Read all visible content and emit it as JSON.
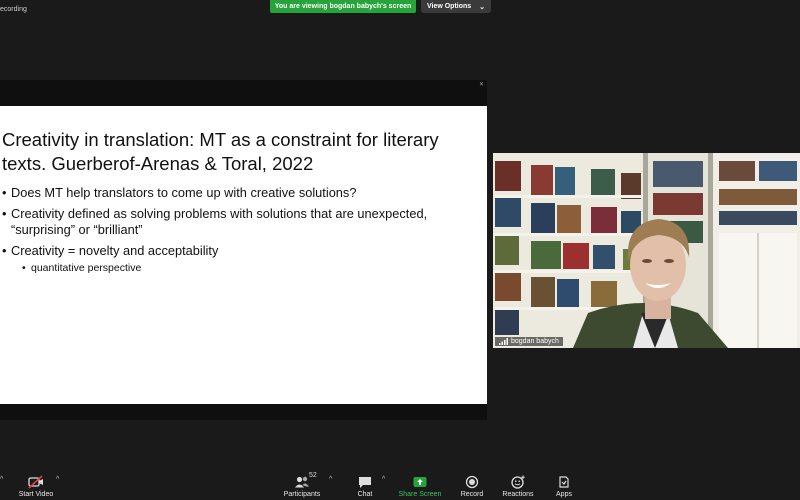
{
  "window": {
    "recording_label": "ecording"
  },
  "banner": {
    "text": "You are viewing bogdan babych's screen"
  },
  "view_options": {
    "label": "View Options",
    "caret": "⌄"
  },
  "slide": {
    "title": "Creativity in translation: MT as a constraint for literary texts. Guerberof-Arenas & Toral, 2022",
    "bullets": [
      "Does MT help translators to come up with creative solutions?",
      "Creativity defined as solving problems with solutions that are unexpected, “surprising” or “brilliant”",
      "Creativity = novelty and acceptability"
    ],
    "sub_bullets": [
      "quantitative perspective"
    ]
  },
  "video": {
    "participant_name": "bogdan babych"
  },
  "toolbar": {
    "start_video": "Start Video",
    "participants": "Participants",
    "participants_count": "52",
    "chat": "Chat",
    "share_screen": "Share Screen",
    "record": "Record",
    "reactions": "Reactions",
    "apps": "Apps"
  },
  "colors": {
    "share_green": "#26a43a",
    "background": "#1a1a1a"
  }
}
